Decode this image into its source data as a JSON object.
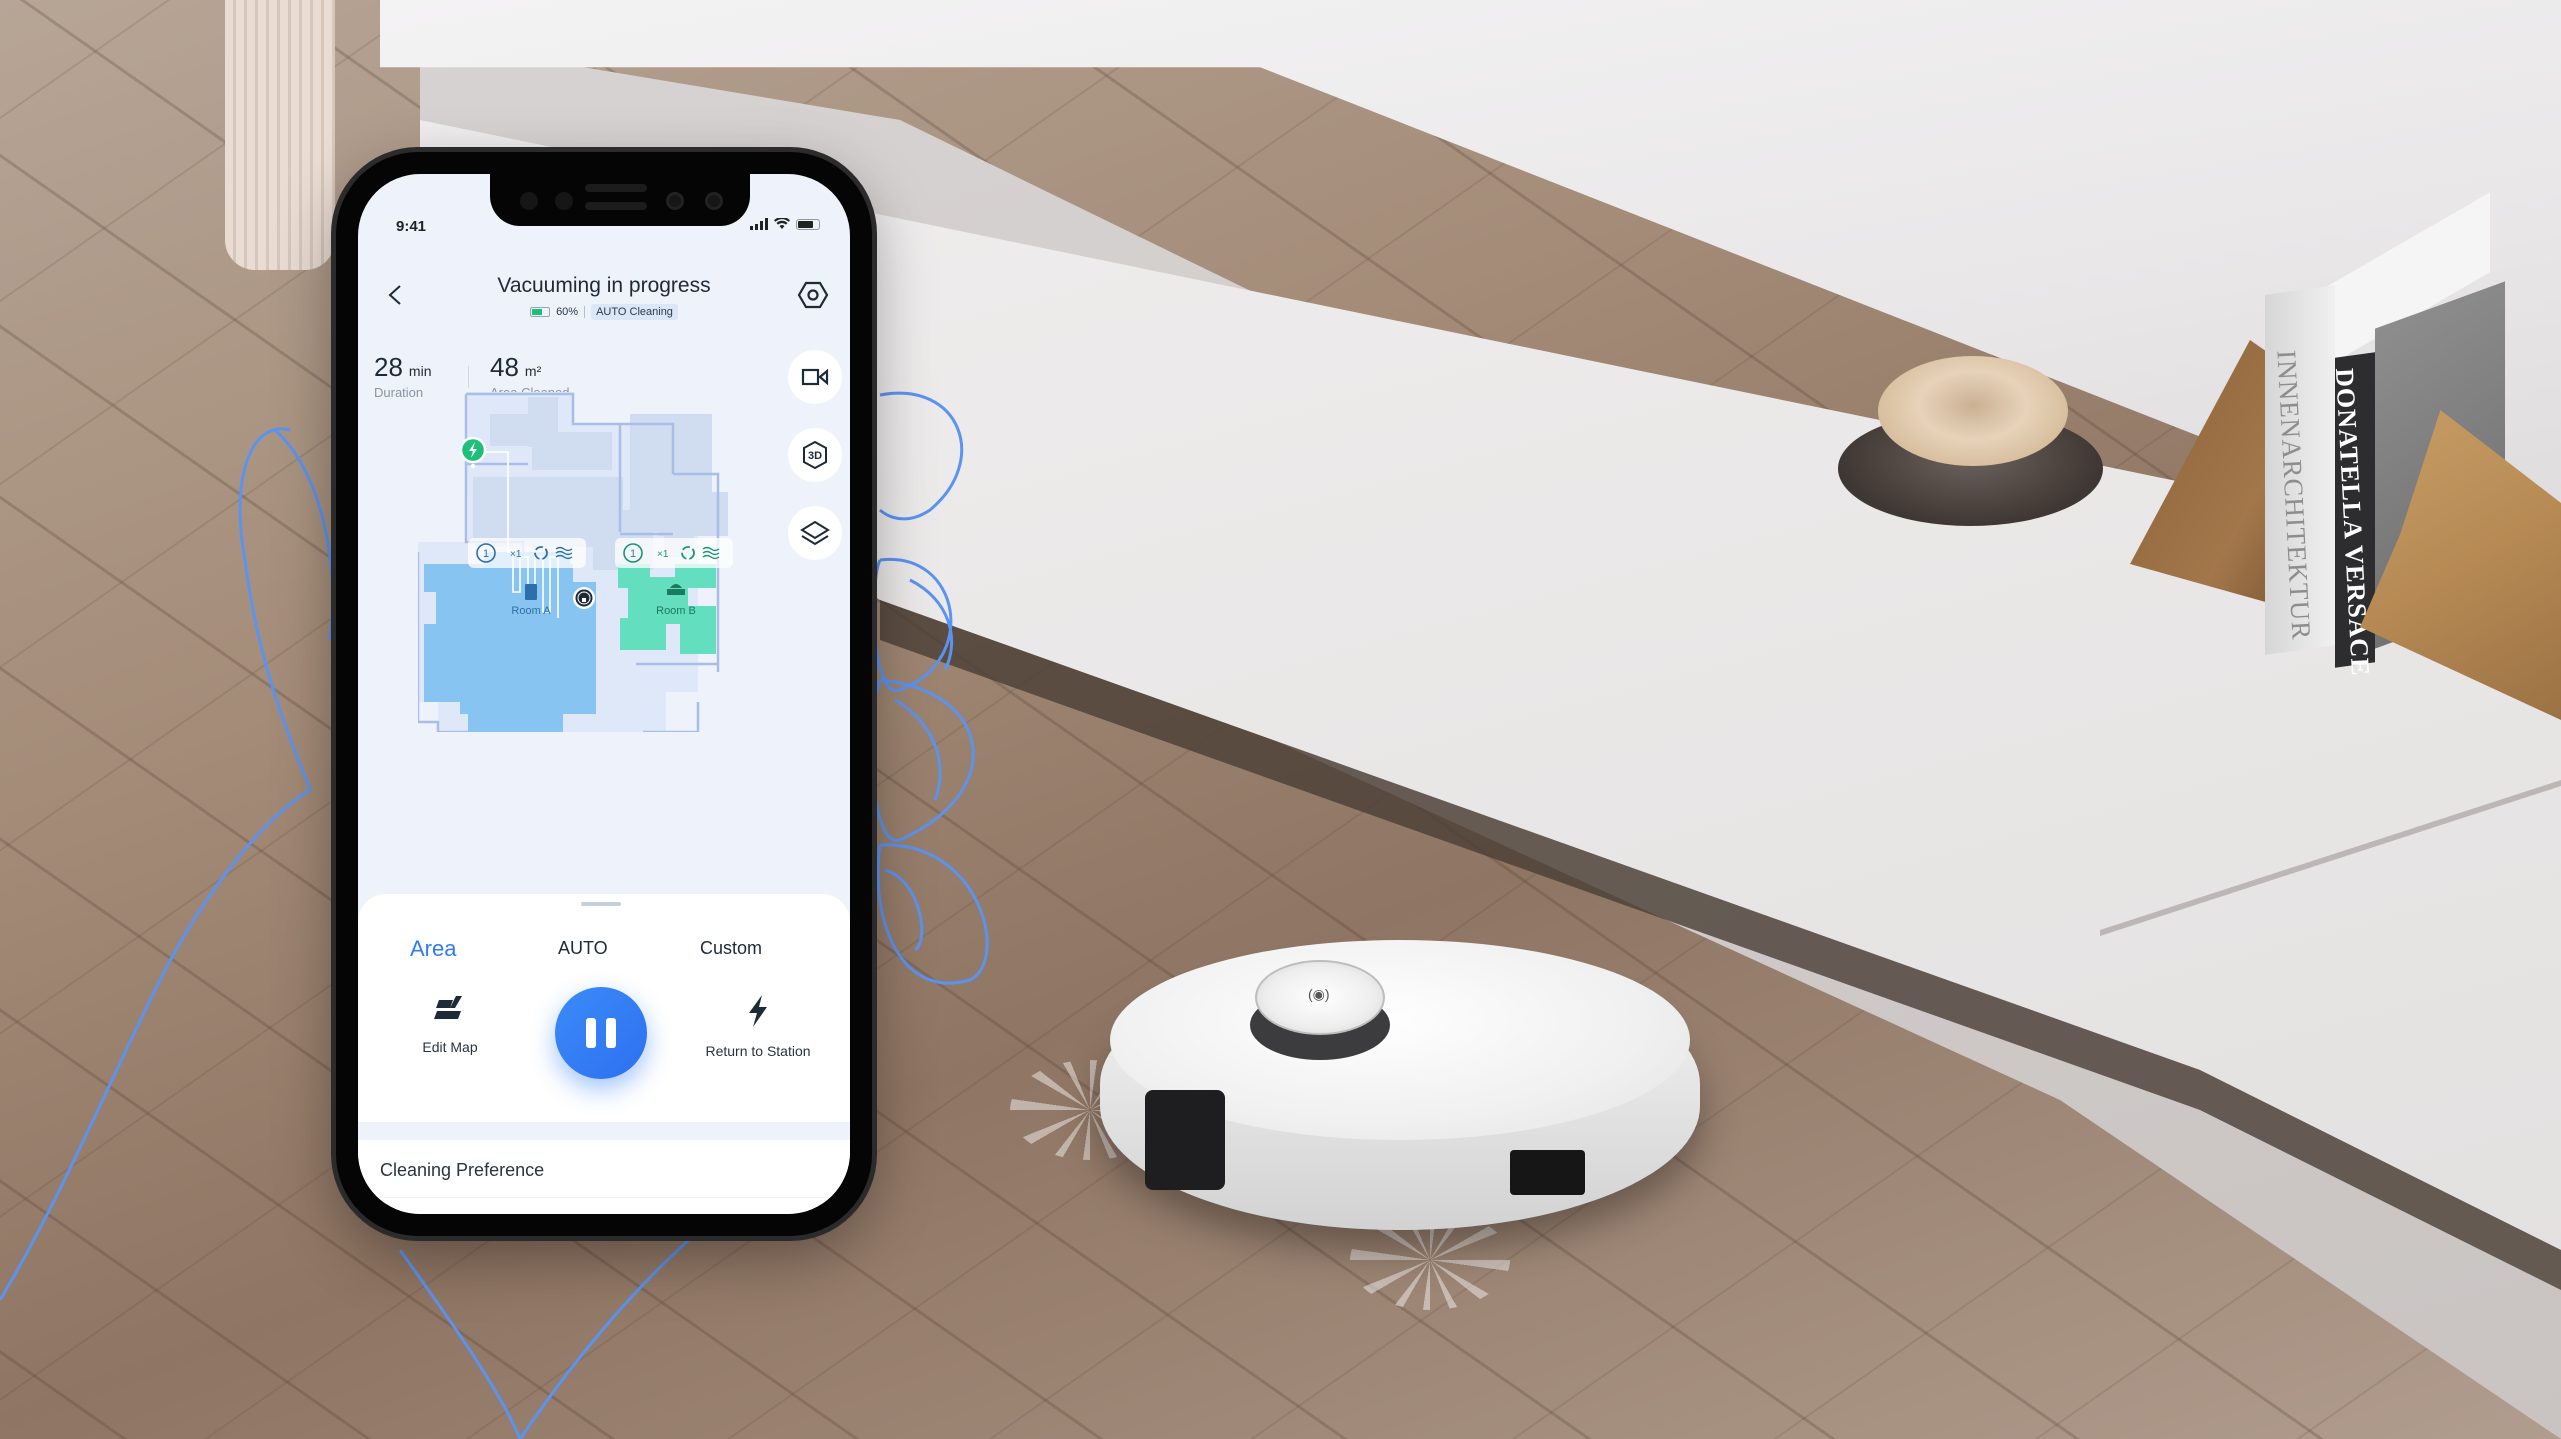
{
  "status_bar": {
    "time": "9:41"
  },
  "header": {
    "title": "Vacuuming in progress",
    "battery_percent": "60%",
    "battery_level": 0.6,
    "mode_tag": "AUTO Cleaning",
    "back_icon": "chevron-left-icon",
    "settings_icon": "hexagon-settings-icon"
  },
  "stats": [
    {
      "value": "28",
      "unit": "min",
      "label": "Duration"
    },
    {
      "value": "48",
      "unit": "m²",
      "label": "Area Cleaned"
    }
  ],
  "side_buttons": [
    {
      "name": "video-camera-icon"
    },
    {
      "name": "3d-map-icon",
      "text": "3D"
    },
    {
      "name": "layers-icon"
    }
  ],
  "map": {
    "rooms": [
      {
        "label": "Room A",
        "passes": "×1",
        "order": "1",
        "color": "#87c4f2",
        "icon": "door-icon"
      },
      {
        "label": "Room B",
        "passes": "×1",
        "order": "1",
        "color": "#63dfbf",
        "icon": "dining-icon"
      }
    ],
    "charger_icon": "lightning-icon",
    "robot_marker": "robot-position-icon"
  },
  "sheet": {
    "tabs": [
      {
        "label": "Area",
        "active": true
      },
      {
        "label": "AUTO",
        "active": false
      },
      {
        "label": "Custom",
        "active": false
      }
    ],
    "actions": {
      "edit_map": "Edit Map",
      "return_station": "Return to Station"
    },
    "pause_icon": "pause-icon",
    "preference_label": "Cleaning Preference"
  },
  "scene": {
    "book_spine_1": "INNENARCHITEKTUR",
    "book_spine_2": "DONATELLA VERSACE",
    "accent_color": "#2f7cf6",
    "hand_outline_color": "#5b93f0"
  }
}
